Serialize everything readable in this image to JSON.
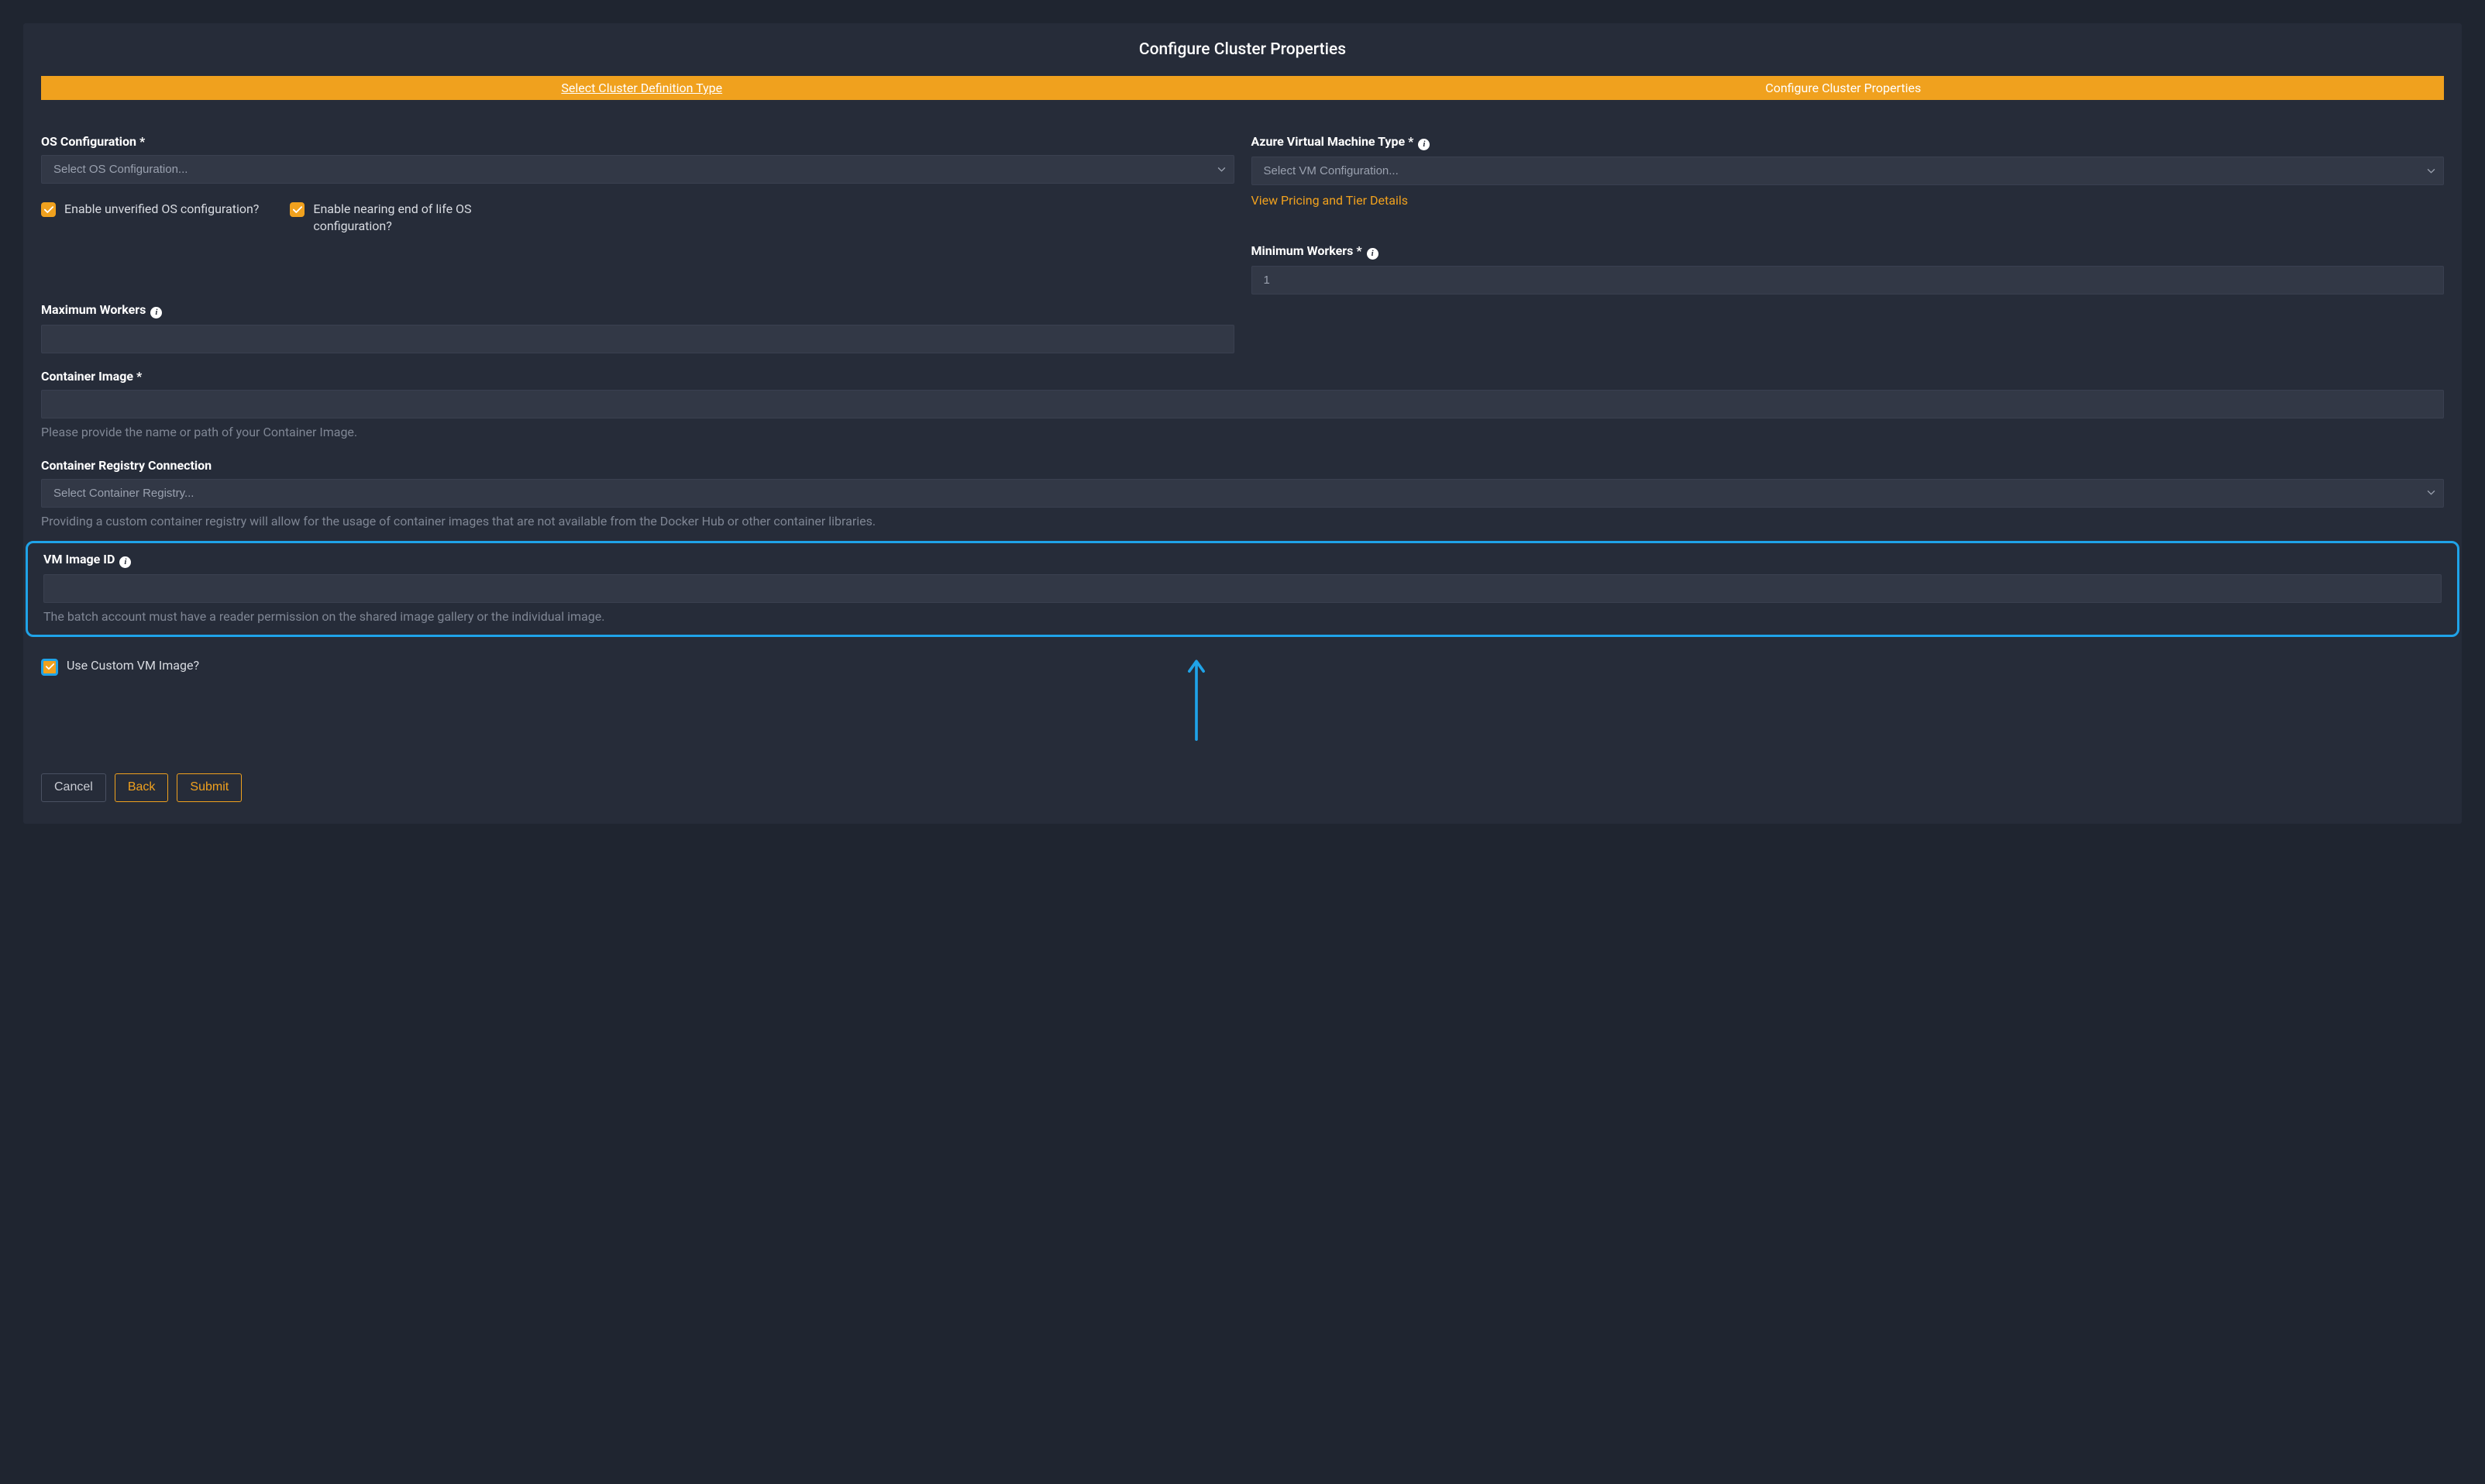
{
  "title": "Configure Cluster Properties",
  "steps": {
    "select_type": "Select Cluster Definition Type",
    "configure": "Configure Cluster Properties"
  },
  "os_config": {
    "label": "OS Configuration *",
    "placeholder": "Select OS Configuration..."
  },
  "vm_type": {
    "label": "Azure Virtual Machine Type *",
    "placeholder": "Select VM Configuration...",
    "pricing_link": "View Pricing and Tier Details"
  },
  "checkboxes": {
    "unverified": "Enable unverified OS configuration?",
    "eol": "Enable nearing end of life OS configuration?",
    "custom_vm": "Use Custom VM Image?"
  },
  "min_workers": {
    "label": "Minimum Workers *",
    "placeholder": "1",
    "value": ""
  },
  "max_workers": {
    "label": "Maximum Workers"
  },
  "container_image": {
    "label": "Container Image *",
    "help": "Please provide the name or path of your Container Image."
  },
  "container_registry": {
    "label": "Container Registry Connection",
    "placeholder": "Select Container Registry...",
    "help": "Providing a custom container registry will allow for the usage of container images that are not available from the Docker Hub or other container libraries."
  },
  "vm_image_id": {
    "label": "VM Image ID",
    "help": "The batch account must have a reader permission on the shared image gallery or the individual image."
  },
  "buttons": {
    "cancel": "Cancel",
    "back": "Back",
    "submit": "Submit"
  }
}
